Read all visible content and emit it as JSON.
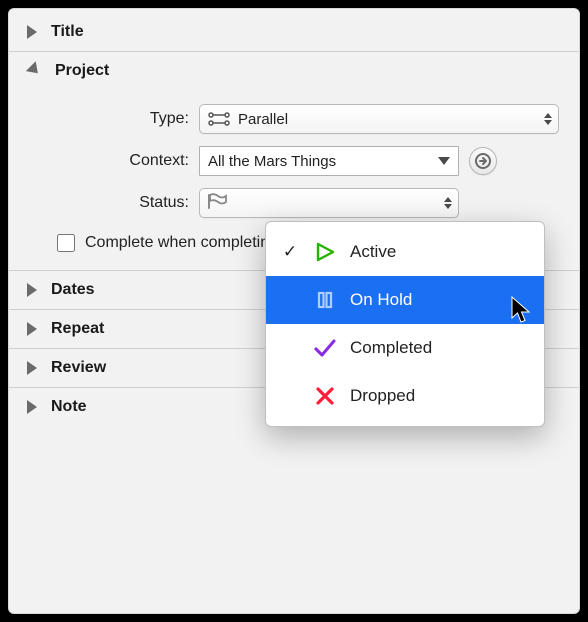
{
  "sections": {
    "title": "Title",
    "project": "Project",
    "dates": "Dates",
    "repeat": "Repeat",
    "review": "Review",
    "note": "Note"
  },
  "project": {
    "type_label": "Type:",
    "type_value": "Parallel",
    "context_label": "Context:",
    "context_value": "All the Mars Things",
    "status_label": "Status:",
    "complete_when_label": "Complete when completing last action"
  },
  "status_menu": {
    "items": [
      {
        "label": "Active",
        "checked": true,
        "color": "#28b200"
      },
      {
        "label": "On Hold",
        "checked": false,
        "color": "#ffffff"
      },
      {
        "label": "Completed",
        "checked": false,
        "color": "#8a2be2"
      },
      {
        "label": "Dropped",
        "checked": false,
        "color": "#ff1f3a"
      }
    ],
    "highlight_index": 1
  }
}
